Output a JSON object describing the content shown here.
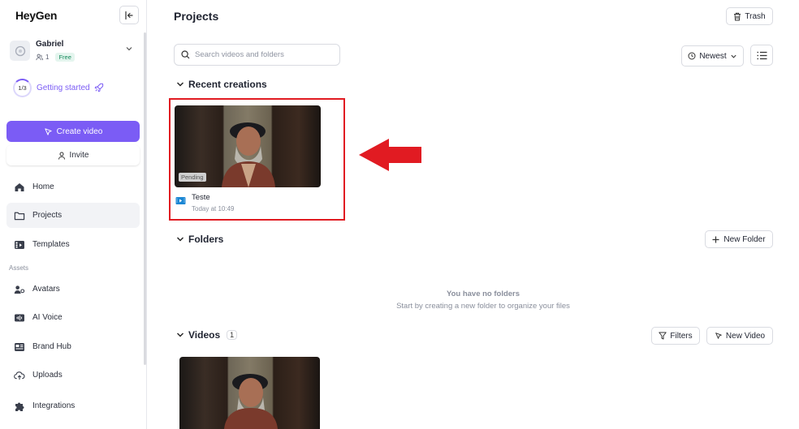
{
  "brand": {
    "logo": "HeyGen",
    "accent": "#7b5cf5",
    "highlight": "#e11b22"
  },
  "account": {
    "name": "Gabriel",
    "members": "1",
    "plan": "Free"
  },
  "getting_started": {
    "progress": "1/3",
    "label": "Getting started",
    "progress_fraction": 0.33
  },
  "actions": {
    "create_video": "Create video",
    "invite": "Invite"
  },
  "nav": {
    "home": "Home",
    "projects": "Projects",
    "templates": "Templates",
    "assets_label": "Assets",
    "avatars": "Avatars",
    "ai_voice": "AI Voice",
    "brand_hub": "Brand Hub",
    "uploads": "Uploads",
    "integrations": "Integrations"
  },
  "page": {
    "title": "Projects",
    "trash": "Trash"
  },
  "search": {
    "placeholder": "Search videos and folders"
  },
  "sort": {
    "selected": "Newest"
  },
  "recent": {
    "heading": "Recent creations",
    "items": [
      {
        "title": "Teste",
        "date": "Today at 10:49",
        "status": "Pending"
      }
    ]
  },
  "folders": {
    "heading": "Folders",
    "new_folder": "New Folder",
    "empty_title": "You have no folders",
    "empty_subtitle": "Start by creating a new folder to organize your files"
  },
  "videos": {
    "heading": "Videos",
    "count": "1",
    "filters": "Filters",
    "new_video": "New Video"
  }
}
